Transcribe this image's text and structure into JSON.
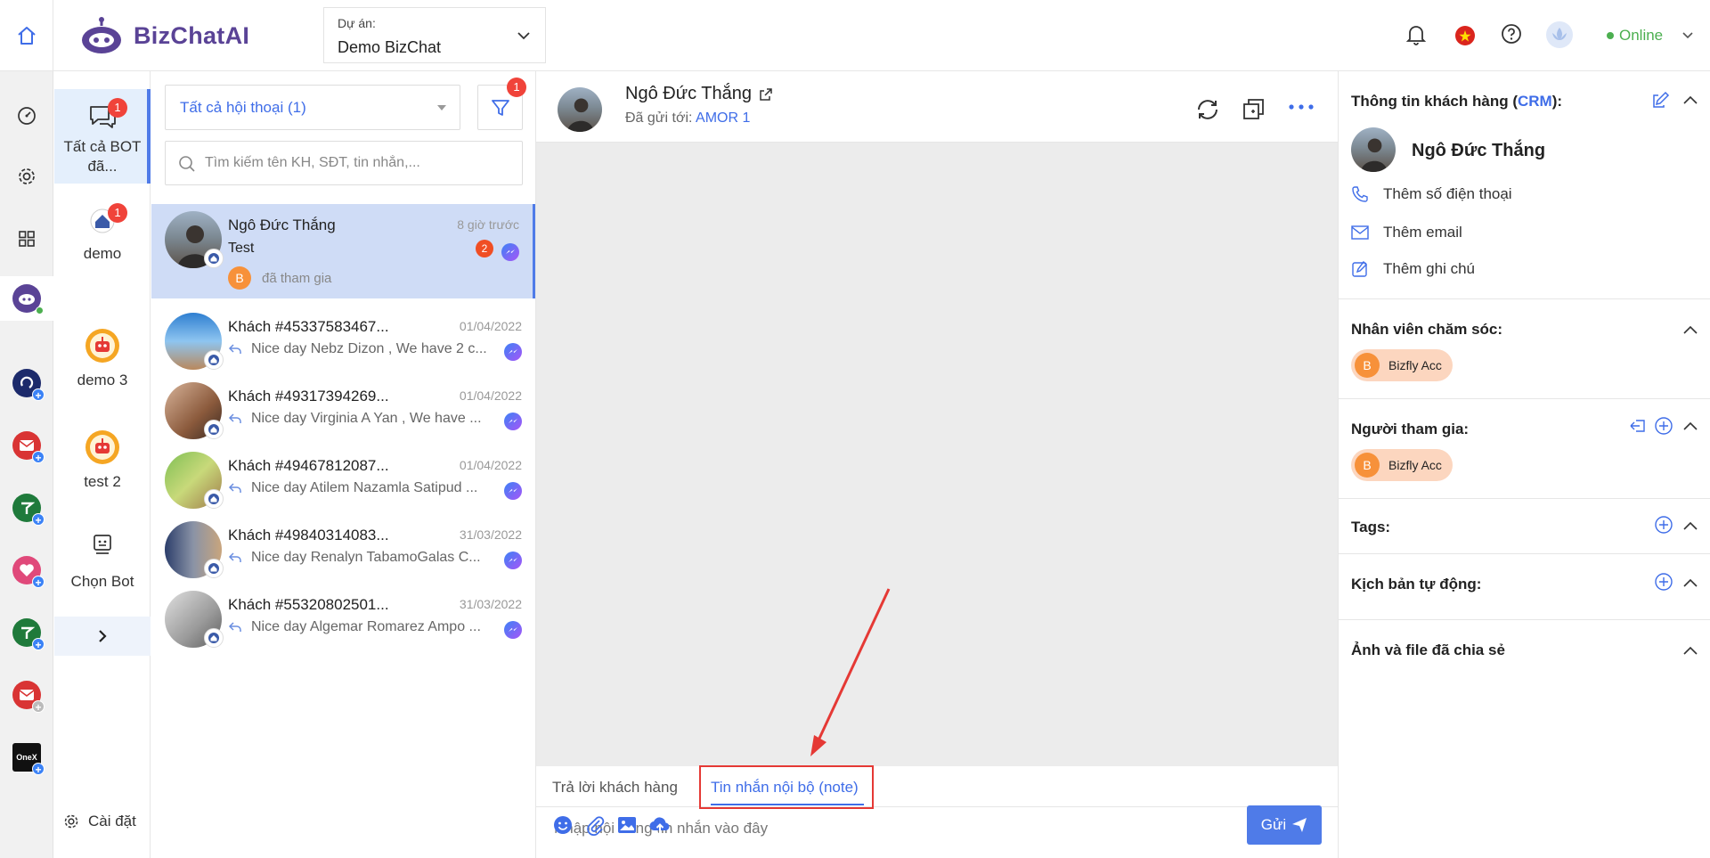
{
  "topbar": {
    "brand": "BizChatAI",
    "project_label": "Dự án:",
    "project_value": "Demo BizChat",
    "status": "Online"
  },
  "botcol": {
    "bots": [
      {
        "label": "Tất cả BOT đã...",
        "badge": "1"
      },
      {
        "label": "demo",
        "badge": "1"
      },
      {
        "label": "demo 3"
      },
      {
        "label": "test 2"
      },
      {
        "label": "Chọn Bot"
      }
    ],
    "settings": "Cài đặt"
  },
  "convlist": {
    "filter_label": "Tất cả hội thoại (1)",
    "filter_badge": "1",
    "search_placeholder": "Tìm kiếm tên KH, SĐT, tin nhắn,...",
    "items": [
      {
        "name": "Ngô Đức Thắng",
        "time": "8 giờ trước",
        "msg": "Test",
        "unread": "2",
        "sub": "B",
        "sub_text": "đã tham gia"
      },
      {
        "name": "Khách #45337583467...",
        "time": "01/04/2022",
        "msg": "Nice day Nebz Dizon , We have 2 c..."
      },
      {
        "name": "Khách #49317394269...",
        "time": "01/04/2022",
        "msg": "Nice day Virginia A Yan , We have ..."
      },
      {
        "name": "Khách #49467812087...",
        "time": "01/04/2022",
        "msg": "Nice day Atilem Nazamla Satipud ..."
      },
      {
        "name": "Khách #49840314083...",
        "time": "31/03/2022",
        "msg": "Nice day Renalyn TabamoGalas C..."
      },
      {
        "name": "Khách #55320802501...",
        "time": "31/03/2022",
        "msg": "Nice day Algemar Romarez Ampo ..."
      }
    ]
  },
  "chat": {
    "name": "Ngô Đức Thắng",
    "sent_to_label": "Đã gửi tới:",
    "sent_to_value": "AMOR 1",
    "tab_reply": "Trả lời khách hàng",
    "tab_note": "Tin nhắn nội bộ (note)",
    "input_placeholder": "Nhập nội dung tin nhắn vào đây",
    "send_label": "Gửi"
  },
  "crm": {
    "title_prefix": "Thông tin khách hàng (",
    "title_link": "CRM",
    "title_suffix": "):",
    "name": "Ngô Đức Thắng",
    "add_phone": "Thêm số điện thoại",
    "add_email": "Thêm email",
    "add_note": "Thêm ghi chú",
    "staff_title": "Nhân viên chăm sóc:",
    "staff_chip": "Bizfly Acc",
    "staff_chip_initial": "B",
    "participants_title": "Người tham gia:",
    "participant_chip": "Bizfly Acc",
    "participant_chip_initial": "B",
    "tags_title": "Tags:",
    "scripts_title": "Kịch bản tự động:",
    "files_title": "Ảnh và file đã chia sẻ"
  },
  "colors": {
    "accent": "#3f6de8",
    "brand": "#5a4396",
    "badge": "#f0433a",
    "annotation": "#e53935"
  }
}
